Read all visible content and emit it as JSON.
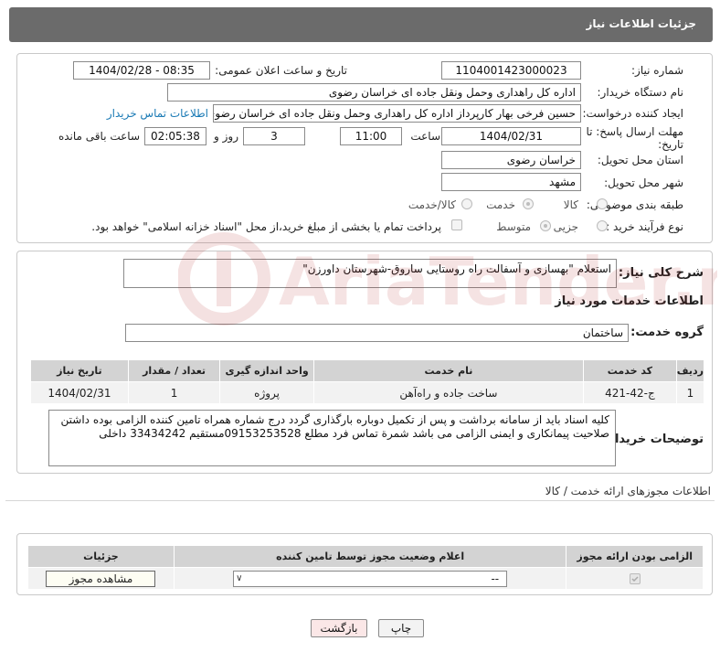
{
  "header": {
    "title": "جزئیات اطلاعات نیاز"
  },
  "form": {
    "need_number": {
      "label": "شماره نیاز:",
      "value": "1104001423000023"
    },
    "announce": {
      "label": "تاریخ و ساعت اعلان عمومی:",
      "value": "1404/02/28 - 08:35"
    },
    "buyer_org": {
      "label": "نام دستگاه خریدار:",
      "value": "اداره کل راهداری وحمل ونقل جاده ای خراسان رضوی"
    },
    "creator": {
      "label": "ایجاد کننده درخواست:",
      "value": "حسین فرخی بهار کارپرداز اداره کل راهداری وحمل ونقل جاده ای خراسان رضوی",
      "contact_link": "اطلاعات تماس خریدار"
    },
    "deadline": {
      "label": "مهلت ارسال پاسخ: تا تاریخ:",
      "date": "1404/02/31",
      "time_label": "ساعت",
      "time": "11:00",
      "days": "3",
      "days_label": "روز و",
      "remaining": "02:05:38",
      "remaining_label": "ساعت باقی مانده"
    },
    "province": {
      "label": "استان محل تحویل:",
      "value": "خراسان رضوی"
    },
    "city": {
      "label": "شهر محل تحویل:",
      "value": "مشهد"
    },
    "category": {
      "label": "طبقه بندی موضوعی:",
      "options": [
        "کالا",
        "خدمت",
        "کالا/خدمت"
      ],
      "selected": "خدمت"
    },
    "purchase_type": {
      "label": "نوع فرآیند خرید :",
      "options": [
        "جزیی",
        "متوسط"
      ],
      "selected": "متوسط",
      "note": "پرداخت تمام یا بخشی از مبلغ خرید،از محل \"اسناد خزانه اسلامی\" خواهد بود."
    }
  },
  "description": {
    "label": "شرح کلی نیاز:",
    "value": "استعلام \"بهسازی و آسفالت راه روستایی ساروق-شهرستان داورزن\""
  },
  "services": {
    "title": "اطلاعات خدمات مورد نیاز",
    "group_label": "گروه خدمت:",
    "group_value": "ساختمان",
    "columns": [
      "ردیف",
      "کد خدمت",
      "نام خدمت",
      "واحد اندازه گیری",
      "تعداد / مقدار",
      "تاریخ نیاز"
    ],
    "rows": [
      {
        "row": "1",
        "code": "ج-42-421",
        "name": "ساخت جاده و راه‌آهن",
        "unit": "پروژه",
        "qty": "1",
        "date": "1404/02/31"
      }
    ]
  },
  "buyer_notes": {
    "label": "توضیحات خریدار:",
    "value": "کلیه اسناد باید از سامانه برداشت و پس از تکمیل دوباره بارگذاری گردد درج شماره همراه تامین کننده الزامی بوده داشتن صلاحیت پیمانکاری و ایمنی الزامی می باشد  شمرة تماس فرد مطلع  09153253528مستقیم 33434242 داخلی"
  },
  "permits": {
    "title": "اطلاعات مجوزهای ارائه خدمت / کالا",
    "columns": [
      "الزامی بودن ارائه مجوز",
      "اعلام وضعیت مجوز توسط تامین کننده",
      "جزئیات"
    ],
    "select_value": "--",
    "view_button": "مشاهده مجوز"
  },
  "actions": {
    "print": "چاپ",
    "back": "بازگشت"
  },
  "watermark": {
    "text": "AriaTender.net"
  }
}
